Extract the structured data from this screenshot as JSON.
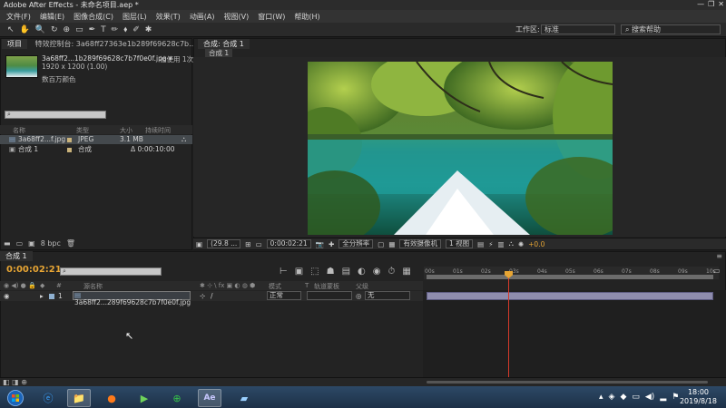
{
  "window": {
    "title": "Adobe After Effects - 未命名项目.aep *",
    "controls": [
      "—",
      "❐",
      "✕"
    ]
  },
  "menu": [
    "文件(F)",
    "编辑(E)",
    "图像合成(C)",
    "图层(L)",
    "效果(T)",
    "动画(A)",
    "视图(V)",
    "窗口(W)",
    "帮助(H)"
  ],
  "toolbar": {
    "tools": [
      "↖",
      "✋",
      "🔍",
      "↻",
      "⊕",
      "▭",
      "✒",
      "T",
      "✏",
      "⬧",
      "✐",
      "✱"
    ],
    "workspace_label": "工作区:",
    "workspace_value": "标准",
    "help_placeholder": "搜索帮助"
  },
  "project": {
    "tab_project": "项目",
    "tab_effects": "特效控制台: 3a68ff27363e1b289f69628c7b...",
    "footage_name": "3a68ff2...1b289f69628c7b7f0e0f.jpg ▾",
    "used_label": "被使用 1次",
    "dimensions": "1920 x 1200 (1.00)",
    "color_label": "数百万颜色",
    "columns": [
      "名称",
      "类型",
      "大小",
      "持续时间"
    ],
    "items": [
      {
        "name": "3a68ff2...f.jpg",
        "type": "JPEG",
        "size": "3.1 MB",
        "duration": "",
        "color": "#c9b27a"
      },
      {
        "name": "合成 1",
        "type": "合成",
        "size": "",
        "duration": "Δ 0:00:10:00",
        "color": "#c9b27a"
      }
    ],
    "bpc": "8 bpc"
  },
  "composition": {
    "tab": "合成: 合成 1",
    "subtab": "合成 1",
    "zoom": "(29.8 ...",
    "timecode": "0:00:02:21",
    "resolution": "全分辨率",
    "camera": "有效摄像机",
    "views": "1 视图",
    "exposure": "+0.0"
  },
  "timeline": {
    "tab": "合成 1",
    "timecode": "0:00:02:21",
    "layer_columns": [
      "源名称",
      "模式",
      "T",
      "轨道蒙板",
      "父级"
    ],
    "layer": {
      "index": "1",
      "name": "3a68ff2...289f69628c7b7f0e0f.jpg",
      "mode": "正常",
      "parent": "无"
    },
    "ruler_ticks": [
      "00s",
      "01s",
      "02s",
      "03s",
      "04s",
      "05s",
      "06s",
      "07s",
      "08s",
      "09s",
      "10s"
    ]
  },
  "taskbar": {
    "apps": [
      "start-orb",
      "ie-icon",
      "explorer-icon",
      "firefox-icon",
      "media-icon",
      "360-icon",
      "ae-icon",
      "notebook-icon"
    ],
    "time": "18:00",
    "date": "2019/8/18"
  }
}
